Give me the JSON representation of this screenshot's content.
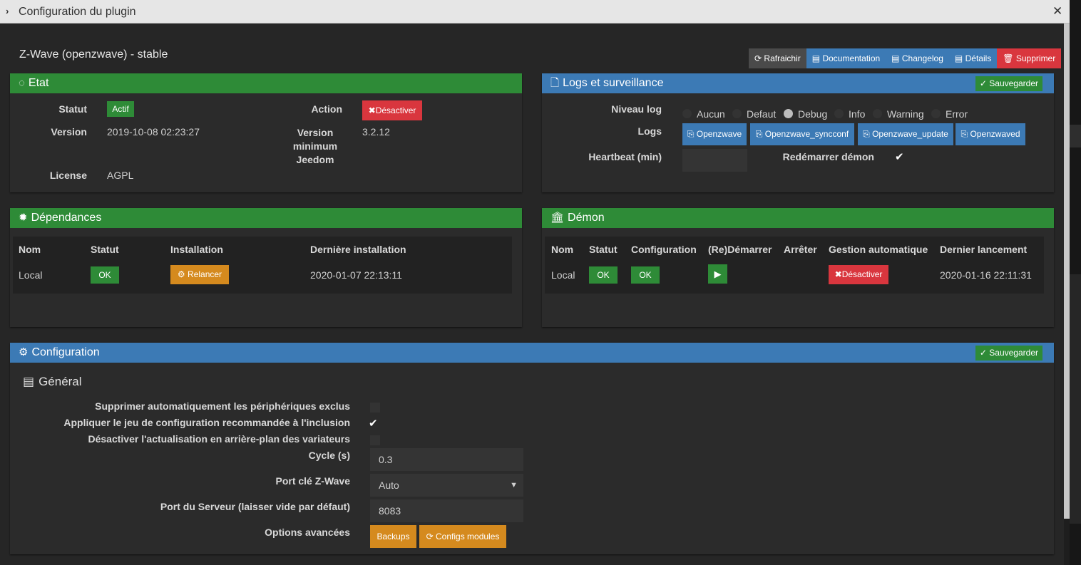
{
  "window": {
    "title": "Configuration du plugin",
    "chevron": "›",
    "close": "✕"
  },
  "plugin": {
    "title": "Z-Wave (openzwave) - stable"
  },
  "toolbar": {
    "refresh": "Rafraichir",
    "documentation": "Documentation",
    "changelog": "Changelog",
    "details": "Détails",
    "delete": "Supprimer"
  },
  "etat": {
    "title": "Etat",
    "statut_label": "Statut",
    "statut_value": "Actif",
    "action_label": "Action",
    "action_button": "Désactiver",
    "version_label": "Version",
    "version_value": "2019-10-08 02:23:27",
    "min_version_label": "Version minimum Jeedom",
    "min_version_value": "3.2.12",
    "license_label": "License",
    "license_value": "AGPL"
  },
  "logs": {
    "title": "Logs et surveillance",
    "save": "Sauvegarder",
    "level_label": "Niveau log",
    "levels": [
      "Aucun",
      "Defaut",
      "Debug",
      "Info",
      "Warning",
      "Error"
    ],
    "selected_level": "Debug",
    "logs_label": "Logs",
    "log_buttons": [
      "Openzwave",
      "Openzwave_syncconf",
      "Openzwave_update",
      "Openzwaved"
    ],
    "heartbeat_label": "Heartbeat (min)",
    "heartbeat_value": "",
    "restart_label": "Redémarrer démon",
    "restart_checked": true
  },
  "dependances": {
    "title": "Dépendances",
    "headers": [
      "Nom",
      "Statut",
      "Installation",
      "Dernière installation"
    ],
    "row": {
      "nom": "Local",
      "statut": "OK",
      "installation": "Relancer",
      "derniere": "2020-01-07 22:13:11"
    }
  },
  "demon": {
    "title": "Démon",
    "headers": [
      "Nom",
      "Statut",
      "Configuration",
      "(Re)Démarrer",
      "Arrêter",
      "Gestion automatique",
      "Dernier lancement"
    ],
    "row": {
      "nom": "Local",
      "statut": "OK",
      "configuration": "OK",
      "gestion": "Désactiver",
      "dernier": "2020-01-16 22:11:31"
    }
  },
  "configuration": {
    "title": "Configuration",
    "save": "Sauvegarder",
    "general_title": "Général",
    "opt1_label": "Supprimer automatiquement les périphériques exclus",
    "opt1_checked": false,
    "opt2_label": "Appliquer le jeu de configuration recommandée à l'inclusion",
    "opt2_checked": true,
    "opt3_label": "Désactiver l'actualisation en arrière-plan des variateurs",
    "opt3_checked": false,
    "cycle_label": "Cycle (s)",
    "cycle_value": "0.3",
    "port_label": "Port clé Z-Wave",
    "port_value": "Auto",
    "server_port_label": "Port du Serveur (laisser vide par défaut)",
    "server_port_value": "8083",
    "advanced_label": "Options avancées",
    "backups": "Backups",
    "configs_modules": "Configs modules"
  },
  "colors": {
    "green": "#2e8b37",
    "blue": "#3c7ab5",
    "red": "#d9363e",
    "orange": "#d58a1e",
    "grey": "#4a4a4a"
  }
}
